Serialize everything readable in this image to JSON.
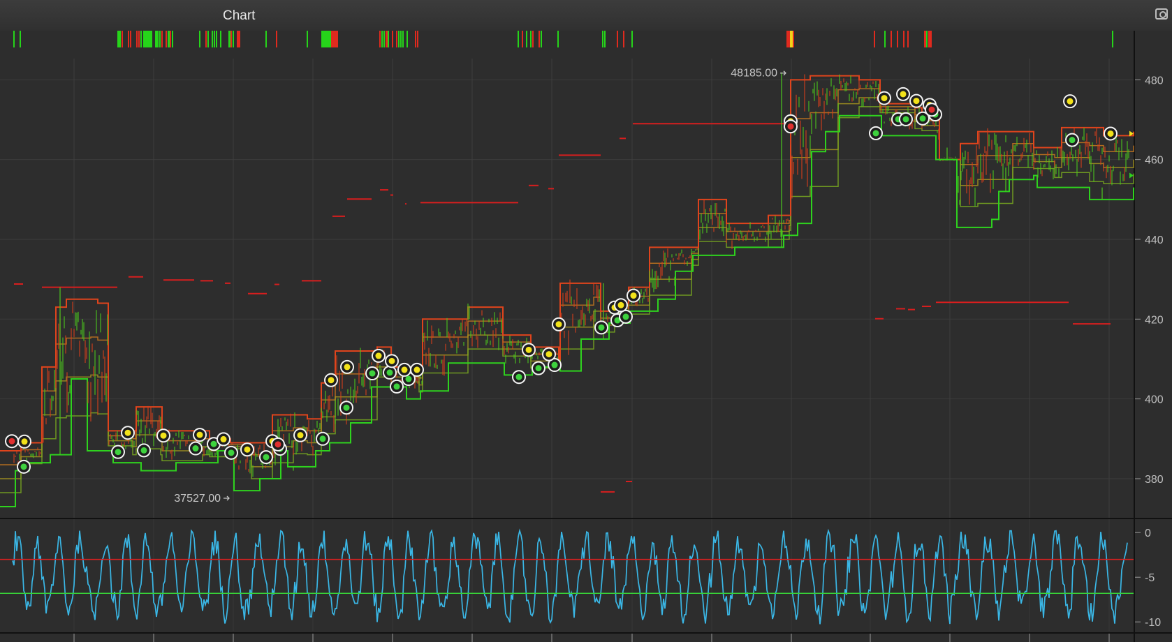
{
  "window": {
    "title": "Chart"
  },
  "icons": {
    "camera": "camera-icon"
  },
  "colors": {
    "background": "#2d2d2d",
    "grid": "#3d3d3d",
    "high_line": "#e0441c",
    "low_line": "#2ed21e",
    "mid_line_1": "#c8781e",
    "mid_line_2": "#a8961e",
    "mid_line_3": "#7aac20",
    "oscillator": "#3ab7e6",
    "overbought": "#e02020",
    "oversold": "#38d038",
    "signal_yellow": "#f2e21a",
    "signal_green": "#3ed23e",
    "signal_red": "#e03030",
    "resistance": "#d81e1e"
  },
  "chart_data": [
    {
      "type": "line",
      "name": "price-panel",
      "y_tick_labels": [
        "480",
        "460",
        "440",
        "420",
        "400",
        "380"
      ],
      "y_ticks": [
        48000,
        46000,
        44000,
        42000,
        40000,
        38000
      ],
      "ylim": [
        37020,
        49230
      ],
      "xlim": [
        0,
        1623
      ],
      "annotations": [
        {
          "text": "48185.00",
          "x": 1125,
          "y": 48185
        },
        {
          "text": "37527.00",
          "x": 328,
          "y": 37527
        }
      ],
      "steps_high": [
        [
          0,
          38700
        ],
        [
          30,
          38900
        ],
        [
          60,
          40800
        ],
        [
          80,
          42300
        ],
        [
          95,
          42500
        ],
        [
          130,
          42500
        ],
        [
          140,
          42400
        ],
        [
          155,
          39200
        ],
        [
          190,
          39200
        ],
        [
          195,
          39800
        ],
        [
          230,
          39800
        ],
        [
          232,
          39200
        ],
        [
          290,
          39200
        ],
        [
          300,
          39000
        ],
        [
          330,
          38900
        ],
        [
          360,
          38900
        ],
        [
          390,
          39600
        ],
        [
          420,
          39600
        ],
        [
          440,
          39500
        ],
        [
          460,
          40400
        ],
        [
          480,
          41200
        ],
        [
          540,
          41300
        ],
        [
          560,
          40800
        ],
        [
          600,
          40700
        ],
        [
          605,
          42000
        ],
        [
          640,
          42000
        ],
        [
          670,
          42300
        ],
        [
          700,
          42300
        ],
        [
          720,
          41600
        ],
        [
          760,
          41300
        ],
        [
          800,
          41000
        ],
        [
          802,
          42900
        ],
        [
          850,
          42900
        ],
        [
          860,
          42200
        ],
        [
          880,
          42400
        ],
        [
          900,
          42800
        ],
        [
          930,
          43800
        ],
        [
          990,
          43800
        ],
        [
          1000,
          45000
        ],
        [
          1030,
          45000
        ],
        [
          1040,
          44400
        ],
        [
          1100,
          44600
        ],
        [
          1130,
          44600
        ],
        [
          1132,
          48000
        ],
        [
          1160,
          48100
        ],
        [
          1200,
          48100
        ],
        [
          1230,
          48000
        ],
        [
          1260,
          47400
        ],
        [
          1310,
          47300
        ],
        [
          1320,
          47100
        ],
        [
          1345,
          46000
        ],
        [
          1375,
          46400
        ],
        [
          1400,
          46700
        ],
        [
          1450,
          46700
        ],
        [
          1480,
          46300
        ],
        [
          1510,
          46300
        ],
        [
          1520,
          46800
        ],
        [
          1560,
          46800
        ],
        [
          1580,
          46600
        ],
        [
          1623,
          46700
        ]
      ],
      "steps_low": [
        [
          0,
          37300
        ],
        [
          20,
          37300
        ],
        [
          22,
          38200
        ],
        [
          40,
          38200
        ],
        [
          42,
          38400
        ],
        [
          70,
          38400
        ],
        [
          72,
          38600
        ],
        [
          100,
          38600
        ],
        [
          102,
          40500
        ],
        [
          120,
          40500
        ],
        [
          125,
          38700
        ],
        [
          160,
          38700
        ],
        [
          162,
          38400
        ],
        [
          200,
          38400
        ],
        [
          202,
          38200
        ],
        [
          250,
          38200
        ],
        [
          252,
          38400
        ],
        [
          310,
          38400
        ],
        [
          312,
          38700
        ],
        [
          330,
          38700
        ],
        [
          335,
          37700
        ],
        [
          370,
          37700
        ],
        [
          372,
          38000
        ],
        [
          400,
          38000
        ],
        [
          402,
          38700
        ],
        [
          410,
          38700
        ],
        [
          412,
          38300
        ],
        [
          450,
          38300
        ],
        [
          452,
          38700
        ],
        [
          470,
          38700
        ],
        [
          472,
          38900
        ],
        [
          500,
          38900
        ],
        [
          502,
          39400
        ],
        [
          530,
          39400
        ],
        [
          532,
          40300
        ],
        [
          580,
          40300
        ],
        [
          582,
          40000
        ],
        [
          600,
          40000
        ],
        [
          602,
          40200
        ],
        [
          640,
          40200
        ],
        [
          642,
          40900
        ],
        [
          720,
          40900
        ],
        [
          722,
          40600
        ],
        [
          760,
          40600
        ],
        [
          762,
          40800
        ],
        [
          800,
          40800
        ],
        [
          802,
          40700
        ],
        [
          830,
          40700
        ],
        [
          832,
          41500
        ],
        [
          870,
          41500
        ],
        [
          872,
          41900
        ],
        [
          900,
          41900
        ],
        [
          902,
          42200
        ],
        [
          940,
          42200
        ],
        [
          942,
          42500
        ],
        [
          965,
          42500
        ],
        [
          967,
          43200
        ],
        [
          990,
          43200
        ],
        [
          992,
          43600
        ],
        [
          1050,
          43600
        ],
        [
          1052,
          43800
        ],
        [
          1120,
          43800
        ],
        [
          1122,
          44100
        ],
        [
          1140,
          44100
        ],
        [
          1142,
          44400
        ],
        [
          1160,
          44400
        ],
        [
          1162,
          46200
        ],
        [
          1180,
          46200
        ],
        [
          1182,
          46700
        ],
        [
          1200,
          46700
        ],
        [
          1202,
          47100
        ],
        [
          1260,
          47100
        ],
        [
          1262,
          46600
        ],
        [
          1300,
          46600
        ],
        [
          1320,
          46600
        ],
        [
          1340,
          46000
        ],
        [
          1370,
          44300
        ],
        [
          1420,
          44500
        ],
        [
          1430,
          45200
        ],
        [
          1445,
          45500
        ],
        [
          1480,
          45600
        ],
        [
          1485,
          45300
        ],
        [
          1550,
          45300
        ],
        [
          1560,
          45000
        ],
        [
          1610,
          45000
        ],
        [
          1623,
          45300
        ]
      ],
      "resistance_segments": [
        {
          "x0": 20,
          "x1": 33,
          "y": 42880
        },
        {
          "x0": 60,
          "x1": 168,
          "y": 42800
        },
        {
          "x0": 184,
          "x1": 205,
          "y": 43060
        },
        {
          "x0": 234,
          "x1": 278,
          "y": 42980
        },
        {
          "x0": 287,
          "x1": 305,
          "y": 42960
        },
        {
          "x0": 322,
          "x1": 330,
          "y": 42900
        },
        {
          "x0": 355,
          "x1": 382,
          "y": 42640
        },
        {
          "x0": 393,
          "x1": 400,
          "y": 42870
        },
        {
          "x0": 432,
          "x1": 460,
          "y": 42960
        },
        {
          "x0": 476,
          "x1": 494,
          "y": 44580
        },
        {
          "x0": 497,
          "x1": 532,
          "y": 45010
        },
        {
          "x0": 544,
          "x1": 556,
          "y": 45240
        },
        {
          "x0": 559,
          "x1": 563,
          "y": 45110
        },
        {
          "x0": 580,
          "x1": 582,
          "y": 44890
        },
        {
          "x0": 602,
          "x1": 742,
          "y": 44920
        },
        {
          "x0": 757,
          "x1": 771,
          "y": 45350
        },
        {
          "x0": 785,
          "x1": 793,
          "y": 45270
        },
        {
          "x0": 800,
          "x1": 860,
          "y": 46110
        },
        {
          "x0": 887,
          "x1": 896,
          "y": 46530
        },
        {
          "x0": 906,
          "x1": 1128,
          "y": 46900
        },
        {
          "x0": 860,
          "x1": 880,
          "y": 37670
        },
        {
          "x0": 896,
          "x1": 905,
          "y": 37930
        },
        {
          "x0": 1253,
          "x1": 1265,
          "y": 42010
        },
        {
          "x0": 1283,
          "x1": 1296,
          "y": 42260
        },
        {
          "x0": 1300,
          "x1": 1310,
          "y": 42240
        },
        {
          "x0": 1320,
          "x1": 1333,
          "y": 42320
        },
        {
          "x0": 1340,
          "x1": 1530,
          "y": 42420
        },
        {
          "x0": 1536,
          "x1": 1590,
          "y": 41880
        }
      ],
      "signals_yellow": [
        [
          35,
          38930
        ],
        [
          183,
          39150
        ],
        [
          234,
          39080
        ],
        [
          286,
          39100
        ],
        [
          320,
          38990
        ],
        [
          354,
          38730
        ],
        [
          390,
          38940
        ],
        [
          430,
          39090
        ],
        [
          474,
          40470
        ],
        [
          497,
          40800
        ],
        [
          542,
          41080
        ],
        [
          561,
          40950
        ],
        [
          579,
          40730
        ],
        [
          597,
          40730
        ],
        [
          757,
          41230
        ],
        [
          786,
          41120
        ],
        [
          800,
          41870
        ],
        [
          880,
          42290
        ],
        [
          889,
          42350
        ],
        [
          907,
          42590
        ],
        [
          1132,
          46960
        ],
        [
          1266,
          47540
        ],
        [
          1293,
          47640
        ],
        [
          1312,
          47470
        ],
        [
          1331,
          47370
        ],
        [
          1532,
          47460
        ],
        [
          1590,
          46650
        ]
      ],
      "signals_green": [
        [
          34,
          38300
        ],
        [
          169,
          38670
        ],
        [
          206,
          38710
        ],
        [
          280,
          38760
        ],
        [
          306,
          38870
        ],
        [
          331,
          38650
        ],
        [
          381,
          38540
        ],
        [
          401,
          38750
        ],
        [
          462,
          39000
        ],
        [
          496,
          39780
        ],
        [
          533,
          40640
        ],
        [
          558,
          40660
        ],
        [
          568,
          40310
        ],
        [
          585,
          40500
        ],
        [
          743,
          40550
        ],
        [
          771,
          40770
        ],
        [
          794,
          40850
        ],
        [
          861,
          41790
        ],
        [
          884,
          41970
        ],
        [
          896,
          42060
        ],
        [
          1254,
          46660
        ],
        [
          1286,
          47010
        ],
        [
          1297,
          47010
        ],
        [
          1321,
          47030
        ],
        [
          1339,
          47130
        ],
        [
          1535,
          46490
        ]
      ],
      "signals_red": [
        [
          17,
          38940
        ],
        [
          1132,
          46830
        ],
        [
          398,
          38860
        ],
        [
          1334,
          47250
        ]
      ]
    },
    {
      "type": "line",
      "name": "oscillator-panel",
      "y_tick_labels": [
        "0",
        "-5",
        "-10"
      ],
      "y_ticks": [
        0,
        -50,
        -100
      ],
      "ylim": [
        -110,
        15
      ],
      "overbought_level": -30,
      "oversold_level": -68
    }
  ]
}
